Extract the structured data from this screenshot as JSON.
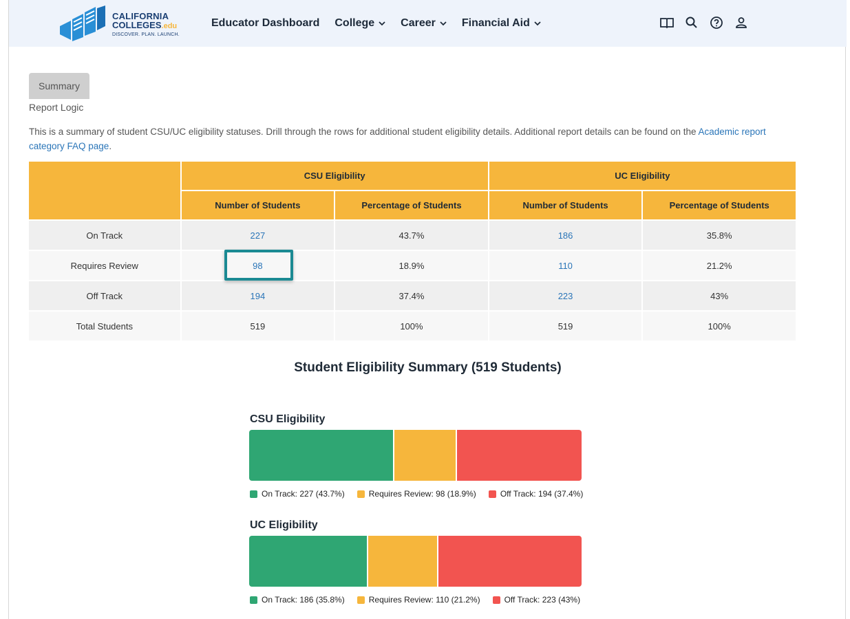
{
  "header": {
    "logo": {
      "line1": "CALIFORNIA",
      "line2": "COLLEGES",
      "line2_suffix": ".edu",
      "tagline": "DISCOVER. PLAN. LAUNCH."
    },
    "nav": [
      {
        "label": "Educator Dashboard",
        "dropdown": false
      },
      {
        "label": "College",
        "dropdown": true
      },
      {
        "label": "Career",
        "dropdown": true
      },
      {
        "label": "Financial Aid",
        "dropdown": true
      }
    ],
    "icons": [
      "book-icon",
      "search-icon",
      "help-icon",
      "user-icon"
    ]
  },
  "tab": {
    "label": "Summary"
  },
  "report_logic": "Report Logic",
  "description": {
    "text": "This is a summary of student CSU/UC eligibility statuses. Drill through the rows for additional student eligibility details. Additional report details can be found on the ",
    "link": "Academic report category FAQ page",
    "end": "."
  },
  "table": {
    "groups": [
      "CSU Eligibility",
      "UC Eligibility"
    ],
    "subheaders": [
      "Number of Students",
      "Percentage of Students",
      "Number of Students",
      "Percentage of Students"
    ],
    "rows": [
      {
        "label": "On Track",
        "csu_count": "227",
        "csu_pct": "43.7%",
        "uc_count": "186",
        "uc_pct": "35.8%"
      },
      {
        "label": "Requires Review",
        "csu_count": "98",
        "csu_pct": "18.9%",
        "uc_count": "110",
        "uc_pct": "21.2%"
      },
      {
        "label": "Off Track",
        "csu_count": "194",
        "csu_pct": "37.4%",
        "uc_count": "223",
        "uc_pct": "43%"
      },
      {
        "label": "Total Students",
        "csu_count": "519",
        "csu_pct": "100%",
        "uc_count": "519",
        "uc_pct": "100%"
      }
    ]
  },
  "colors": {
    "on_track": "#2fa673",
    "requires_review": "#f6b63c",
    "off_track": "#f25450",
    "header_orange": "#f6b63c",
    "link_blue": "#2a75b8",
    "highlight": "#1b8a93"
  },
  "chart_data": {
    "type": "bar",
    "stacked": true,
    "orientation": "horizontal",
    "title": "Student Eligibility Summary (519 Students)",
    "charts": [
      {
        "title": "CSU Eligibility",
        "segments": [
          {
            "name": "On Track",
            "value": 227,
            "pct": 43.7,
            "legend": "On Track: 227  (43.7%)"
          },
          {
            "name": "Requires Review",
            "value": 98,
            "pct": 18.9,
            "legend": "Requires Review: 98  (18.9%)"
          },
          {
            "name": "Off Track",
            "value": 194,
            "pct": 37.4,
            "legend": "Off Track: 194  (37.4%)"
          }
        ]
      },
      {
        "title": "UC Eligibility",
        "segments": [
          {
            "name": "On Track",
            "value": 186,
            "pct": 35.8,
            "legend": "On Track: 186  (35.8%)"
          },
          {
            "name": "Requires Review",
            "value": 110,
            "pct": 21.2,
            "legend": "Requires Review: 110  (21.2%)"
          },
          {
            "name": "Off Track",
            "value": 223,
            "pct": 43,
            "legend": "Off Track: 223  (43%)"
          }
        ]
      }
    ]
  }
}
